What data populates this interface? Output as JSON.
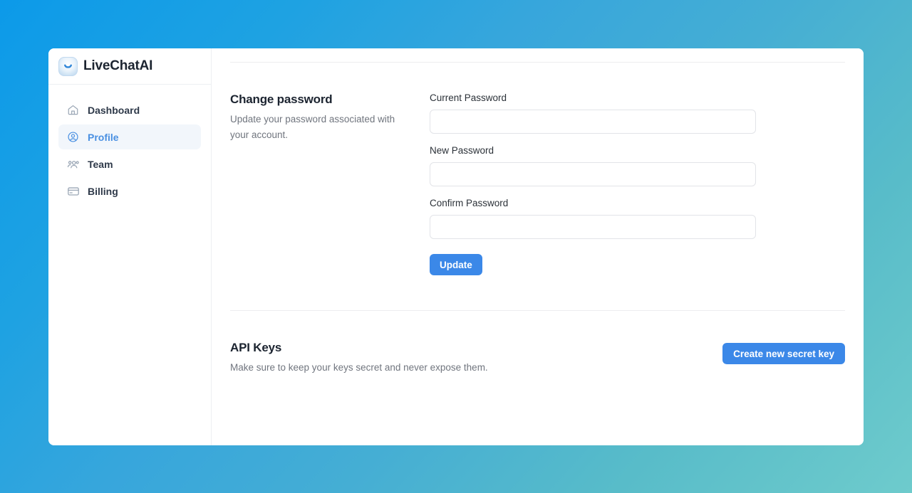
{
  "brand": {
    "name": "LiveChatAI",
    "logo_icon": "chat-smile-logo-icon"
  },
  "sidebar": {
    "items": [
      {
        "label": "Dashboard",
        "icon": "home-icon",
        "active": false
      },
      {
        "label": "Profile",
        "icon": "user-circle-icon",
        "active": true
      },
      {
        "label": "Team",
        "icon": "users-group-icon",
        "active": false
      },
      {
        "label": "Billing",
        "icon": "credit-card-icon",
        "active": false
      }
    ]
  },
  "password_section": {
    "title": "Change password",
    "description": "Update your password associated with your account.",
    "fields": [
      {
        "label": "Current Password",
        "value": "",
        "placeholder": ""
      },
      {
        "label": "New Password",
        "value": "",
        "placeholder": ""
      },
      {
        "label": "Confirm Password",
        "value": "",
        "placeholder": ""
      }
    ],
    "submit_label": "Update"
  },
  "api_keys_section": {
    "title": "API Keys",
    "description": "Make sure to keep your keys secret and never expose them.",
    "create_label": "Create new secret key"
  },
  "colors": {
    "accent_blue": "#3b88e8",
    "active_nav_text": "#4a90e2",
    "active_nav_bg": "#f2f6fb",
    "background_gradient_start": "#0c9ae9",
    "background_gradient_end": "#6ecbcc",
    "card_background": "#ffffff",
    "divider": "#ededef",
    "input_border": "#e2e4e8",
    "heading_text": "#1c2430",
    "muted_text": "#70757e"
  }
}
